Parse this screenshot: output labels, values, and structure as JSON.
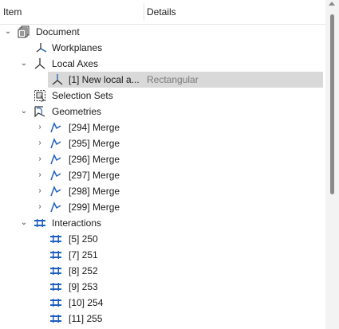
{
  "header": {
    "item_col": "Item",
    "details_col": "Details"
  },
  "tree": {
    "document": {
      "label": "Document",
      "icon": "document-icon",
      "expanded": true
    },
    "workplanes": {
      "label": "Workplanes",
      "icon": "workplane-icon"
    },
    "local_axes": {
      "label": "Local Axes",
      "icon": "axes-icon",
      "expanded": true,
      "items": [
        {
          "label": "[1] New local a...",
          "details": "Rectangular",
          "selected": true
        }
      ]
    },
    "selection_sets": {
      "label": "Selection Sets",
      "icon": "selection-icon"
    },
    "geometries": {
      "label": "Geometries",
      "icon": "geometry-icon",
      "expanded": true,
      "items": [
        {
          "label": "[294] Merge"
        },
        {
          "label": "[295] Merge"
        },
        {
          "label": "[296] Merge"
        },
        {
          "label": "[297] Merge"
        },
        {
          "label": "[298] Merge"
        },
        {
          "label": "[299] Merge"
        }
      ]
    },
    "interactions": {
      "label": "Interactions",
      "icon": "interaction-icon",
      "expanded": true,
      "items": [
        {
          "label": "[5] 250"
        },
        {
          "label": "[7] 251"
        },
        {
          "label": "[8] 252"
        },
        {
          "label": "[9] 253"
        },
        {
          "label": "[10] 254"
        },
        {
          "label": "[11] 255"
        }
      ]
    }
  },
  "colors": {
    "selection": "#d9d9d9",
    "icon_blue": "#1f5fbf",
    "icon_dark": "#333333"
  }
}
